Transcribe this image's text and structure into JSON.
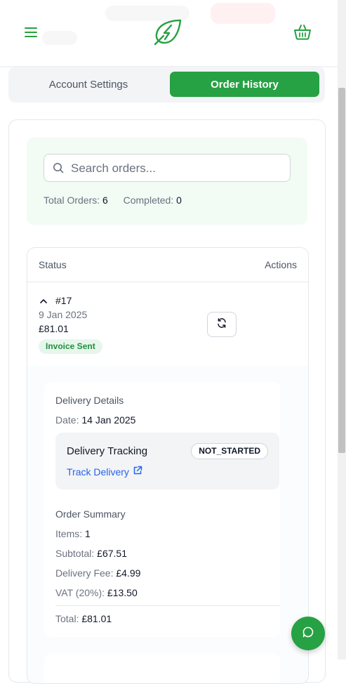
{
  "header": {
    "menu_icon": "hamburger-menu-icon",
    "logo_icon": "leaf-bolt-logo-icon",
    "basket_icon": "shopping-basket-icon"
  },
  "tabs": [
    {
      "label": "Account Settings",
      "active": false
    },
    {
      "label": "Order History",
      "active": true
    }
  ],
  "search": {
    "placeholder": "Search orders...",
    "value": "",
    "icon": "search-icon"
  },
  "stats": {
    "total_label": "Total Orders:",
    "total_value": "6",
    "completed_label": "Completed:",
    "completed_value": "0"
  },
  "table": {
    "headers": {
      "status": "Status",
      "actions": "Actions"
    }
  },
  "order": {
    "number": "#17",
    "date": "9 Jan 2025",
    "total": "£81.01",
    "badge": "Invoice Sent",
    "expanded": true,
    "reorder_icon": "refresh-icon"
  },
  "delivery": {
    "title": "Delivery Details",
    "date_label": "Date:",
    "date_value": "14 Jan 2025",
    "tracking_title": "Delivery Tracking",
    "tracking_status": "NOT_STARTED",
    "track_link": "Track Delivery"
  },
  "summary": {
    "title": "Order Summary",
    "items_label": "Items:",
    "items_value": "1",
    "subtotal_label": "Subtotal:",
    "subtotal_value": "£67.51",
    "delivery_fee_label": "Delivery Fee:",
    "delivery_fee_value": "£4.99",
    "vat_label": "VAT (20%):",
    "vat_value": "£13.50",
    "total_label": "Total:",
    "total_value": "£81.01"
  },
  "colors": {
    "brand_green": "#26a143",
    "link_blue": "#2563eb",
    "badge_bg": "#e7f6ec"
  }
}
